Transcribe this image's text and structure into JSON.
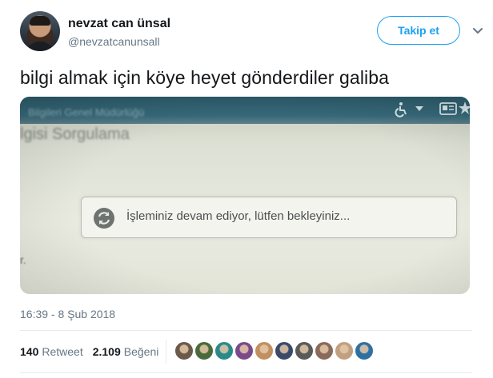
{
  "author": {
    "name": "nevzat can ünsal",
    "handle": "@nevzatcanunsall"
  },
  "follow_button": {
    "label": "Takip et"
  },
  "more_menu": {
    "icon": "chevron-down-icon"
  },
  "tweet": {
    "text": "bilgi almak için köye heyet gönderdiler galiba",
    "timestamp": "16:39 - 8 Şub 2018"
  },
  "media": {
    "blurred_header": "Bilgileri Genel Müdürlüğü",
    "blurred_title": "lgisi Sorgulama",
    "blurred_edge": "r.",
    "loading_message": "İşleminiz devam ediyor, lütfen bekleyiniz...",
    "icons": [
      "wheelchair-icon",
      "dropdown-caret-icon",
      "id-card-icon",
      "star-icon",
      "refresh-spinner-icon"
    ]
  },
  "stats": {
    "retweets": "140",
    "retweets_label": "Retweet",
    "likes": "2.109",
    "likes_label": "Beğeni"
  },
  "likers": {
    "colors": [
      "#6b5a4a",
      "#4a6a3c",
      "#2a8a8a",
      "#7a4a8a",
      "#c09060",
      "#3a4a6a",
      "#5a5a5a",
      "#8a6a5a",
      "#c0a080",
      "#3070a0"
    ]
  },
  "colors": {
    "accent": "#1da1f2",
    "secondary_text": "#657786"
  }
}
